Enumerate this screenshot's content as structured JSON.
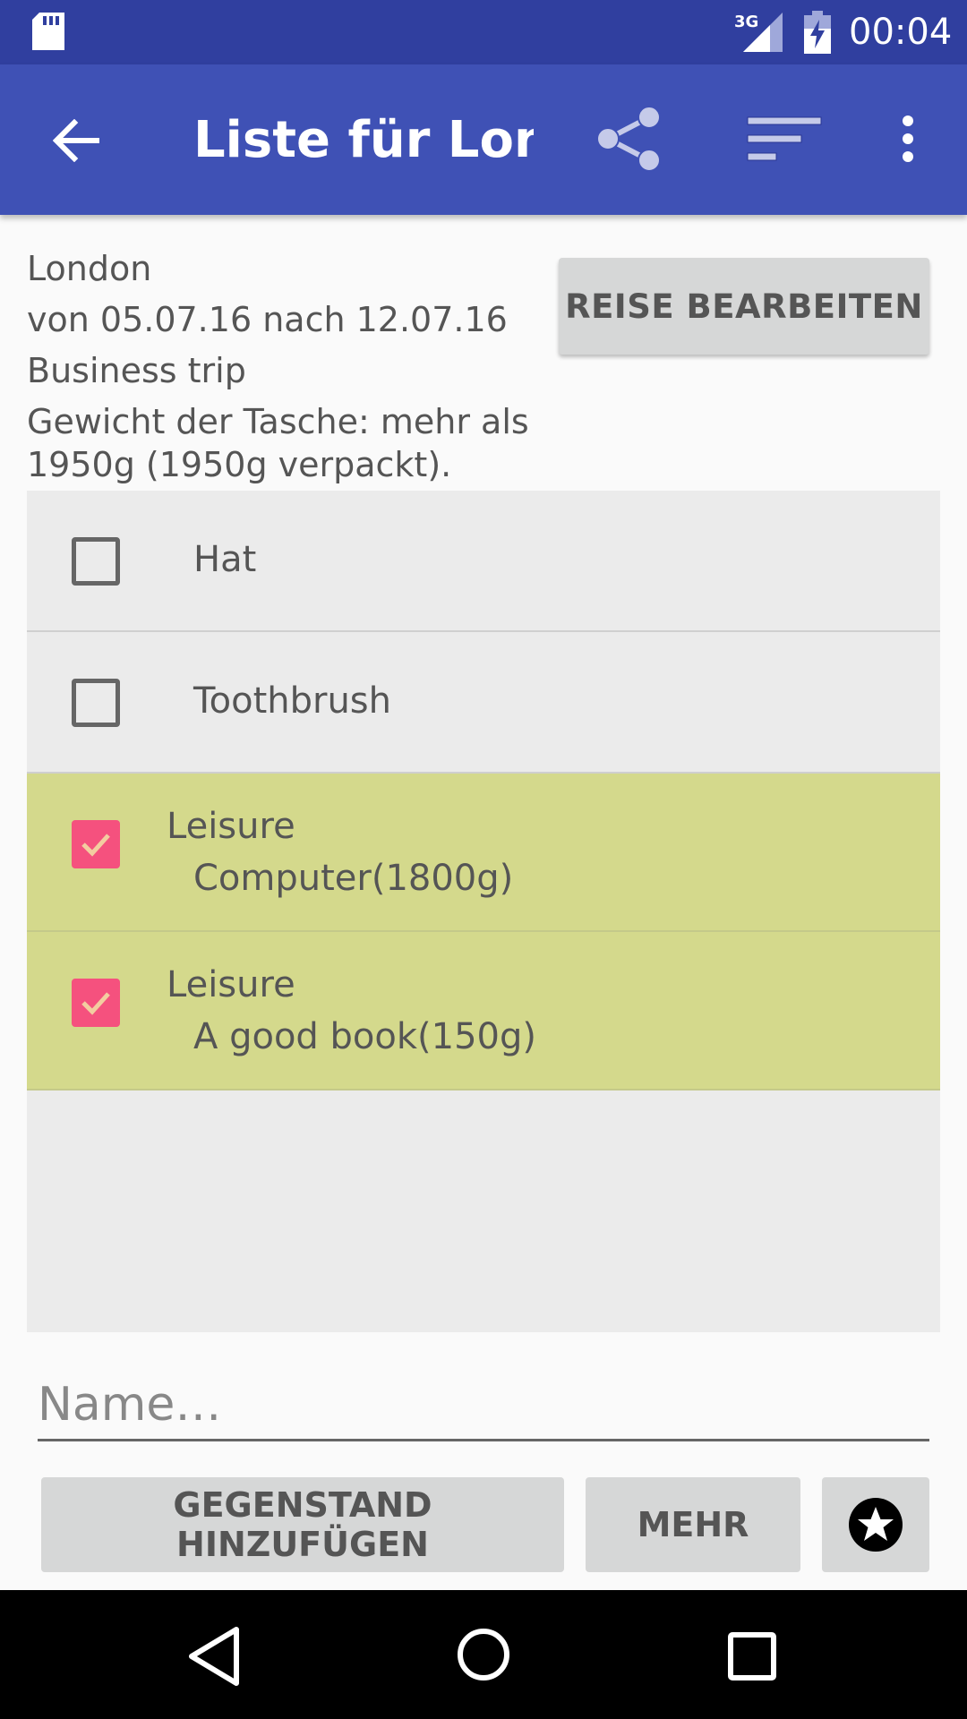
{
  "status_bar": {
    "network": "3G",
    "time": "00:04"
  },
  "app_bar": {
    "title": "Liste für Lon…",
    "icons": [
      "back-arrow-icon",
      "share-icon",
      "sort-icon",
      "overflow-menu-icon"
    ]
  },
  "trip": {
    "destination": "London",
    "dates": "von 05.07.16 nach 12.07.16",
    "type": "Business trip",
    "weight": "Gewicht der Tasche: mehr als 1950g (1950g verpackt).",
    "edit_label": "REISE BEARBEITEN"
  },
  "items": [
    {
      "category": "",
      "name": "Hat",
      "checked": false
    },
    {
      "category": "",
      "name": "Toothbrush",
      "checked": false
    },
    {
      "category": "Leisure",
      "name": "Computer(1800g)",
      "checked": true
    },
    {
      "category": "Leisure",
      "name": "A good book(150g)",
      "checked": true
    }
  ],
  "input": {
    "placeholder": "Name…",
    "value": ""
  },
  "buttons": {
    "add_item": "GEGENSTAND HINZUFÜGEN",
    "more": "MEHR",
    "favorite_icon": "star-circle-icon"
  },
  "colors": {
    "status_bar": "#303f9f",
    "app_bar": "#3f51b5",
    "packed_row": "#d4d98c",
    "checkbox_checked": "#f5517e"
  }
}
